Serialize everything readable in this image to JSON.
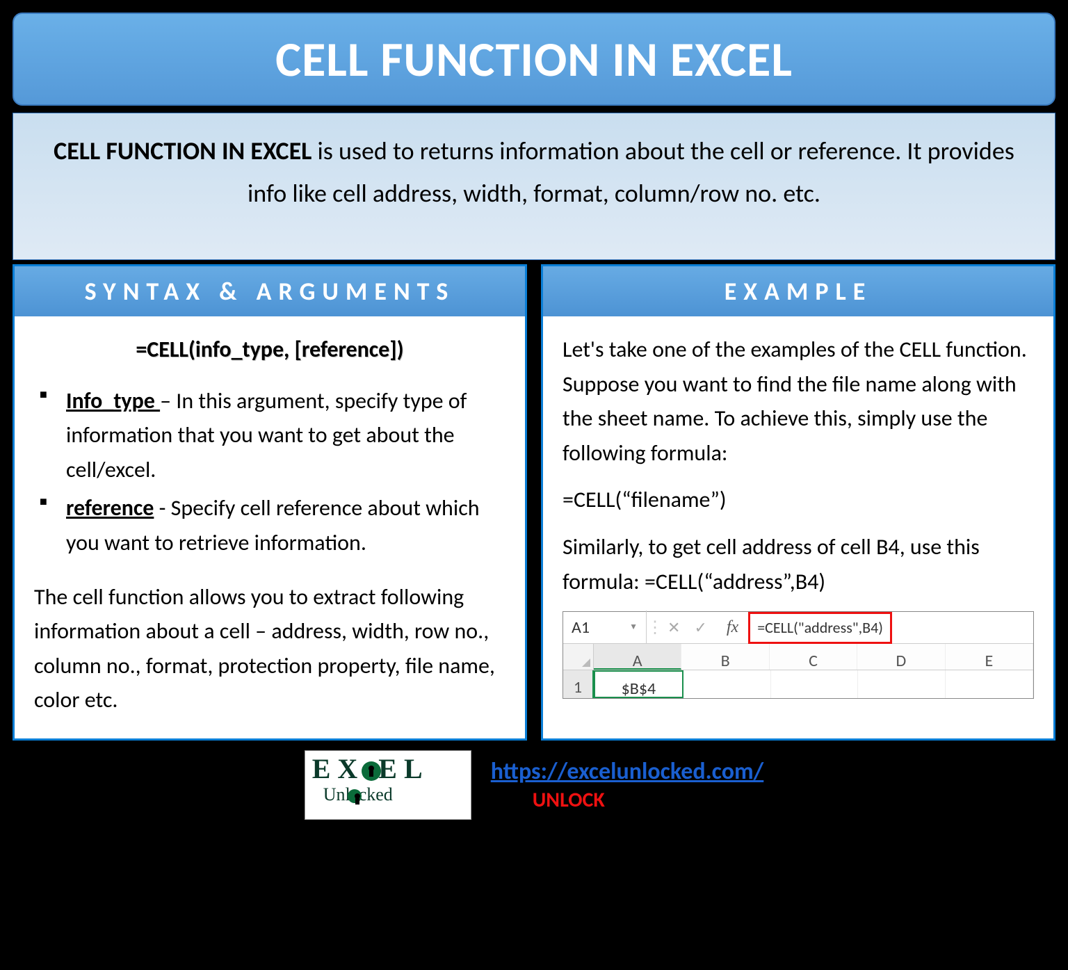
{
  "title": "CELL FUNCTION IN EXCEL",
  "intro": {
    "lead": "CELL FUNCTION IN EXCEL",
    "rest": " is used to returns information about the cell or reference. It provides info like cell address, width, format, column/row no. etc."
  },
  "syntax": {
    "header": "SYNTAX & ARGUMENTS",
    "formula": "=CELL(info_type, [reference])",
    "args": [
      {
        "name": "Info_type ",
        "desc": "– In this argument, specify type of information that you want to get about the cell/excel."
      },
      {
        "name": "reference",
        "desc": " - Specify cell reference about which you want to retrieve information."
      }
    ],
    "note": "The cell function allows you to extract following information about a cell – address, width, row no., column no., format, protection property, file name, color etc."
  },
  "example": {
    "header": "EXAMPLE",
    "p1": "Let's take one of the examples of the CELL function. Suppose you want to find the file name along with the sheet name. To achieve this, simply use the following formula:",
    "formula1": "=CELL(“filename”)",
    "p2": "Similarly, to get cell address of cell B4, use this formula: =CELL(“address”,B4)",
    "screenshot": {
      "namebox": "A1",
      "fx_label": "fx",
      "formula_bar": "=CELL(\"address\",B4)",
      "columns": [
        "A",
        "B",
        "C",
        "D",
        "E"
      ],
      "row_num": "1",
      "a1_value": "$B$4"
    }
  },
  "footer": {
    "logo_main": "EX   EL",
    "logo_sub": "Unl   cked",
    "link": "https://excelunlocked.com/",
    "unlock": "UNLOCK"
  }
}
